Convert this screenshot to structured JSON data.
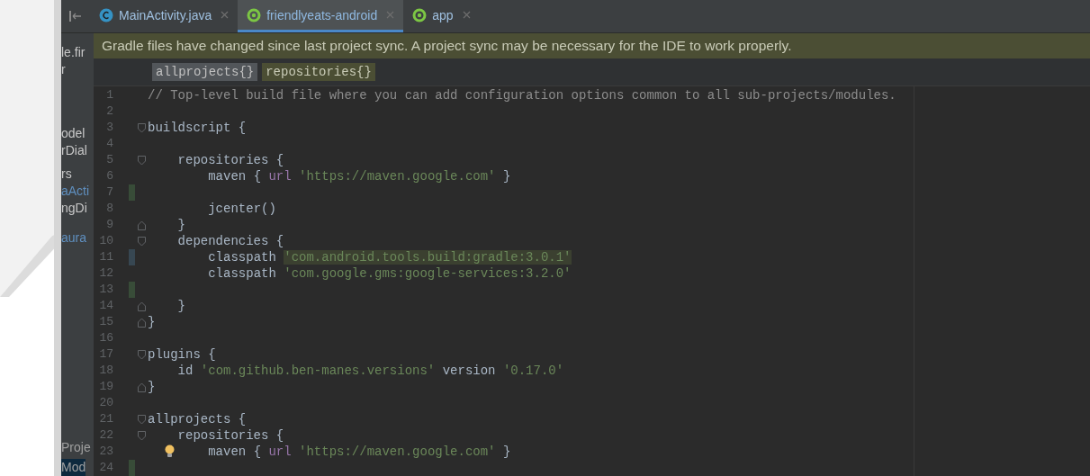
{
  "tabs": [
    {
      "label": "MainActivity.java",
      "kind": "class",
      "selected": false
    },
    {
      "label": "friendlyeats-android",
      "kind": "gradle",
      "selected": true
    },
    {
      "label": "app",
      "kind": "gradle",
      "selected": false
    }
  ],
  "banner": {
    "text": "Gradle files have changed since last project sync. A project sync may be necessary for the IDE to work properly."
  },
  "breadcrumbs": [
    {
      "label": "allprojects{}",
      "selected": false
    },
    {
      "label": "repositories{}",
      "selected": true
    }
  ],
  "project_panel": {
    "items": [
      {
        "label": "le.fir",
        "color": "#c8c8c8",
        "selected": false
      },
      {
        "label": "r",
        "color": "#c8c8c8",
        "selected": false
      },
      {
        "label": "odel",
        "color": "#c8c8c8",
        "selected": false
      },
      {
        "label": "rDial",
        "color": "#c8c8c8",
        "selected": false
      },
      {
        "label": "rs",
        "color": "#c8c8c8",
        "selected": false
      },
      {
        "label": "aActi",
        "color": "#5f8fbf",
        "selected": false
      },
      {
        "label": "ngDi",
        "color": "#c8c8c8",
        "selected": false
      },
      {
        "label": "aura",
        "color": "#5f8fbf",
        "selected": false
      }
    ],
    "tool_windows": [
      {
        "label": "Proje",
        "selected": false
      },
      {
        "label": "Mod",
        "selected": true
      }
    ]
  },
  "editor": {
    "lines": [
      {
        "number": "1",
        "fold_start": false,
        "fold_end": false,
        "added": false,
        "modified": false,
        "bulb": false,
        "tokens": [
          {
            "t": "// Top-level build file where you can add configuration options common to all sub-projects/modules.",
            "kind": "comment"
          }
        ]
      },
      {
        "number": "2",
        "fold_start": false,
        "fold_end": false,
        "added": false,
        "modified": false,
        "bulb": false
      },
      {
        "number": "3",
        "fold_start": true,
        "fold_end": false,
        "added": false,
        "modified": false,
        "bulb": false,
        "tokens": [
          {
            "t": "buildscript {",
            "kind": "plain"
          }
        ]
      },
      {
        "number": "4",
        "fold_start": false,
        "fold_end": false,
        "added": false,
        "modified": false,
        "bulb": false
      },
      {
        "number": "5",
        "fold_start": true,
        "fold_end": false,
        "added": false,
        "modified": false,
        "bulb": false,
        "tokens": [
          {
            "t": "    repositories {",
            "kind": "plain"
          }
        ]
      },
      {
        "number": "6",
        "fold_start": false,
        "fold_end": false,
        "added": false,
        "modified": false,
        "bulb": false,
        "tokens": [
          {
            "t": "        maven { ",
            "kind": "plain"
          },
          {
            "t": "url",
            "kind": "keyword"
          },
          {
            "t": " 'https://maven.google.com'",
            "kind": "string"
          },
          {
            "t": " }",
            "kind": "plain"
          }
        ]
      },
      {
        "number": "7",
        "fold_start": false,
        "fold_end": false,
        "added": true,
        "modified": false,
        "bulb": false
      },
      {
        "number": "8",
        "fold_start": false,
        "fold_end": false,
        "added": false,
        "modified": false,
        "bulb": false,
        "tokens": [
          {
            "t": "        jcenter()",
            "kind": "plain"
          }
        ]
      },
      {
        "number": "9",
        "fold_start": false,
        "fold_end": true,
        "added": false,
        "modified": false,
        "bulb": false,
        "tokens": [
          {
            "t": "    }",
            "kind": "plain"
          }
        ]
      },
      {
        "number": "10",
        "fold_start": true,
        "fold_end": false,
        "added": false,
        "modified": false,
        "bulb": false,
        "tokens": [
          {
            "t": "    dependencies {",
            "kind": "plain"
          }
        ]
      },
      {
        "number": "11",
        "fold_start": false,
        "fold_end": false,
        "added": false,
        "modified": true,
        "bulb": false,
        "tokens": [
          {
            "t": "        classpath ",
            "kind": "plain"
          },
          {
            "t": "'com.android.tools.build:gradle:3.0.1'",
            "kind": "highlighted-string"
          }
        ]
      },
      {
        "number": "12",
        "fold_start": false,
        "fold_end": false,
        "added": false,
        "modified": false,
        "bulb": false,
        "tokens": [
          {
            "t": "        classpath ",
            "kind": "plain"
          },
          {
            "t": "'com.google.gms:google-services:3.2.0'",
            "kind": "string"
          }
        ]
      },
      {
        "number": "13",
        "fold_start": false,
        "fold_end": false,
        "added": true,
        "modified": false,
        "bulb": false
      },
      {
        "number": "14",
        "fold_start": false,
        "fold_end": true,
        "added": false,
        "modified": false,
        "bulb": false,
        "tokens": [
          {
            "t": "    }",
            "kind": "plain"
          }
        ]
      },
      {
        "number": "15",
        "fold_start": false,
        "fold_end": true,
        "added": false,
        "modified": false,
        "bulb": false,
        "tokens": [
          {
            "t": "}",
            "kind": "plain"
          }
        ]
      },
      {
        "number": "16",
        "fold_start": false,
        "fold_end": false,
        "added": false,
        "modified": false,
        "bulb": false
      },
      {
        "number": "17",
        "fold_start": true,
        "fold_end": false,
        "added": false,
        "modified": false,
        "bulb": false,
        "tokens": [
          {
            "t": "plugins {",
            "kind": "plain"
          }
        ]
      },
      {
        "number": "18",
        "fold_start": false,
        "fold_end": false,
        "added": false,
        "modified": false,
        "bulb": false,
        "tokens": [
          {
            "t": "    id ",
            "kind": "plain"
          },
          {
            "t": "'com.github.ben-manes.versions'",
            "kind": "string"
          },
          {
            "t": " version ",
            "kind": "plain"
          },
          {
            "t": "'0.17.0'",
            "kind": "string"
          }
        ]
      },
      {
        "number": "19",
        "fold_start": false,
        "fold_end": true,
        "added": false,
        "modified": false,
        "bulb": false,
        "tokens": [
          {
            "t": "}",
            "kind": "plain"
          }
        ]
      },
      {
        "number": "20",
        "fold_start": false,
        "fold_end": false,
        "added": false,
        "modified": false,
        "bulb": false
      },
      {
        "number": "21",
        "fold_start": true,
        "fold_end": false,
        "added": false,
        "modified": false,
        "bulb": false,
        "tokens": [
          {
            "t": "allprojects {",
            "kind": "plain"
          }
        ]
      },
      {
        "number": "22",
        "fold_start": true,
        "fold_end": false,
        "added": false,
        "modified": false,
        "bulb": false,
        "tokens": [
          {
            "t": "    repositories {",
            "kind": "plain"
          }
        ]
      },
      {
        "number": "23",
        "fold_start": false,
        "fold_end": false,
        "added": false,
        "modified": false,
        "bulb": true,
        "tokens": [
          {
            "t": "        maven { ",
            "kind": "plain"
          },
          {
            "t": "url",
            "kind": "keyword"
          },
          {
            "t": " 'https://maven.google.com'",
            "kind": "string"
          },
          {
            "t": " }",
            "kind": "plain"
          }
        ]
      },
      {
        "number": "24",
        "fold_start": false,
        "fold_end": false,
        "added": true,
        "modified": false,
        "bulb": false
      }
    ]
  }
}
